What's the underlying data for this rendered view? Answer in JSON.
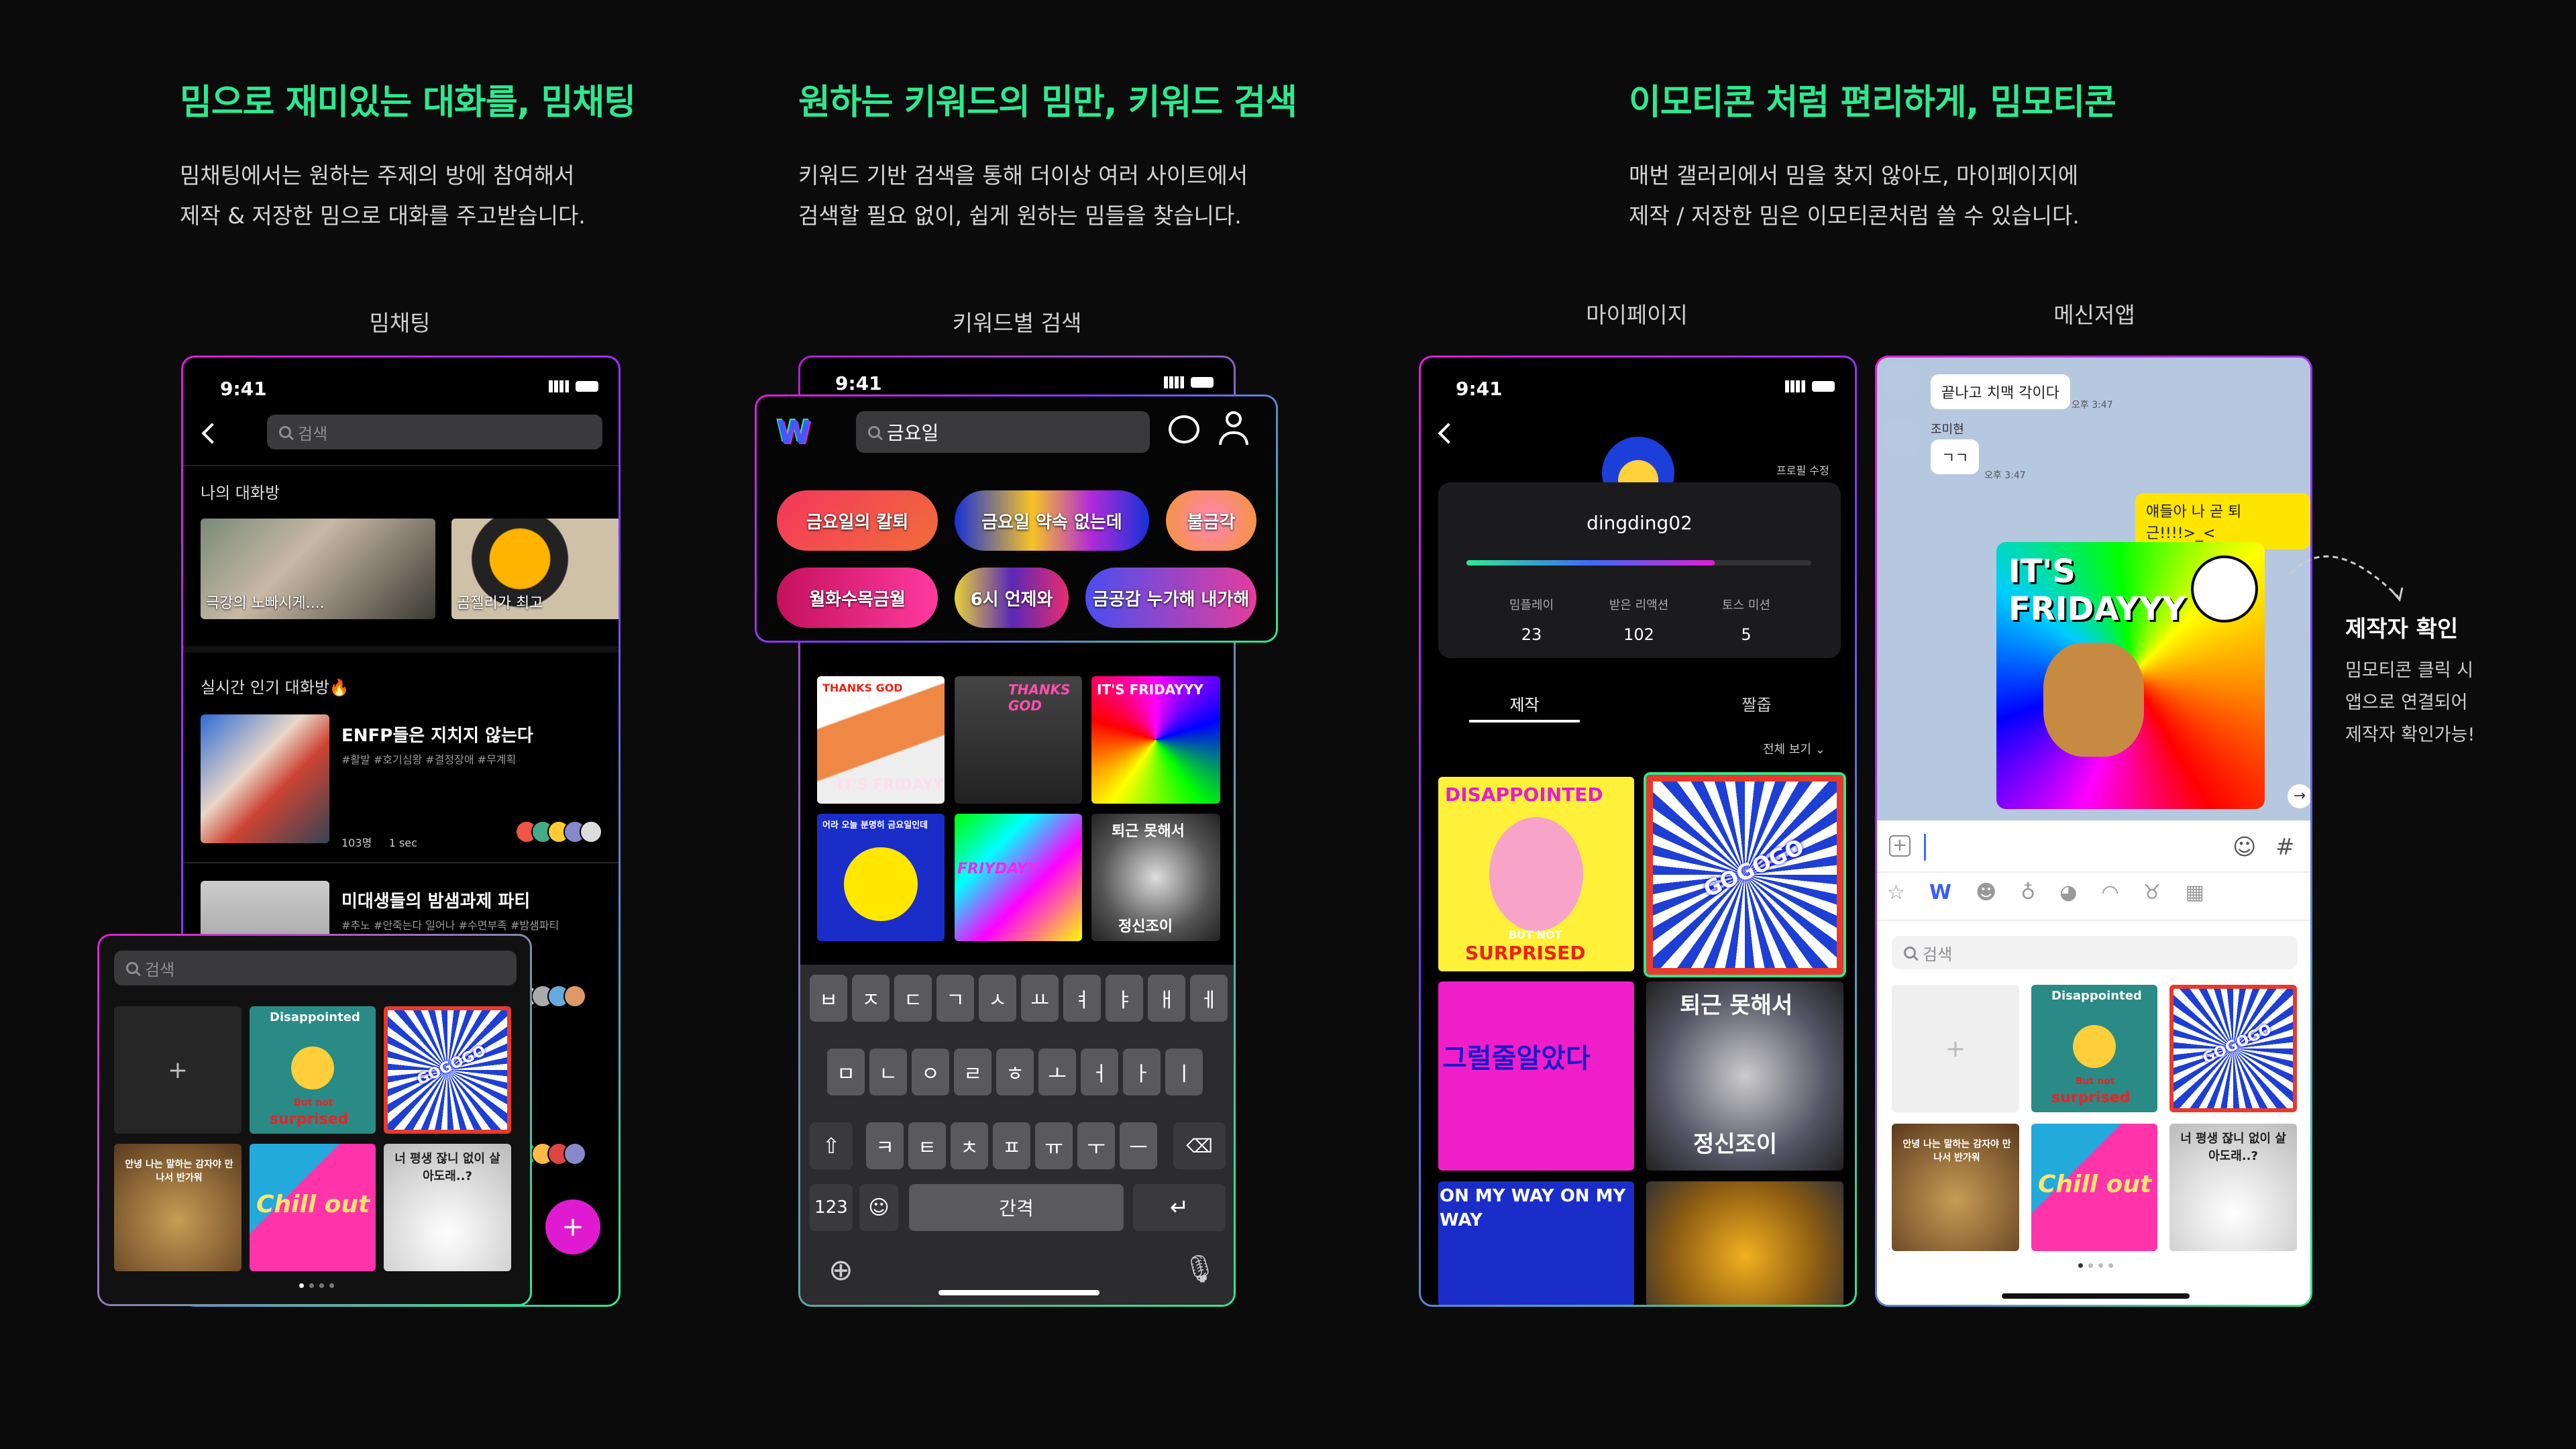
{
  "sections": [
    {
      "title": "밈으로 재미있는 대화를, 밈채팅",
      "desc1": "밈채팅에서는 원하는 주제의 방에 참여해서",
      "desc2": "제작 & 저장한 밈으로 대화를 주고받습니다."
    },
    {
      "title": "원하는 키워드의 밈만, 키워드 검색",
      "desc1": "키워드 기반 검색을 통해 더이상 여러 사이트에서",
      "desc2": "검색할 필요 없이, 쉽게 원하는 밈들을 찾습니다."
    },
    {
      "title": "이모티콘 처럼 편리하게, 밈모티콘",
      "desc1": "매번 갤러리에서 밈을 찾지 않아도, 마이페이지에",
      "desc2": "제작 / 저장한 밈은 이모티콘처럼 쓸 수 있습니다."
    }
  ],
  "labels": {
    "chat": "밈채팅",
    "keyword": "키워드별 검색",
    "mypage": "마이페이지",
    "messenger": "메신저앱"
  },
  "status_time": "9:41",
  "chat": {
    "search_placeholder": "검색",
    "my_rooms": "나의 대화방",
    "rooms": [
      "극강의 노빠시게....",
      "곰젤리가 최고"
    ],
    "popular": "실시간 인기 대화방🔥",
    "hot": [
      {
        "title": "ENFP들은 지치지 않는다",
        "tags": "#활발 #호기심왕 #결정장애 #무계획",
        "count": "103명",
        "time": "1 sec"
      },
      {
        "title": "미대생들의 밤샘과제 파티",
        "tags": "#추노 #안죽는다 일어나 #수면부족 #밤샘파티"
      }
    ],
    "fab": "+",
    "picker_search": "검색",
    "picker_add": "+",
    "memes": [
      "Disappointed",
      "But not",
      "surprised",
      "GOGOGO",
      "안녕 나는 말하는 감자야 만나서 반가워",
      "Chill out",
      "너 평생 잖니 없이 살아도래..?"
    ]
  },
  "keyword": {
    "query": "금요일",
    "chips": [
      "금요일의 칼퇴",
      "금요일 약속 없는데",
      "불금각",
      "월화수목금월",
      "6시 언제와",
      "금공감 누가해 내가해"
    ],
    "tiles": [
      "THANKS GOD",
      "IT'S FRIDAYY",
      "THANKS GOD",
      "IT'S FRIDAYYY",
      "어라 오늘 분명히 금요일인데",
      "FRIYDAYY",
      "퇴근 못해서",
      "정신조이"
    ],
    "rows": [
      [
        "ㅂ",
        "ㅈ",
        "ㄷ",
        "ㄱ",
        "ㅅ",
        "ㅛ",
        "ㅕ",
        "ㅑ",
        "ㅐ",
        "ㅔ"
      ],
      [
        "ㅁ",
        "ㄴ",
        "ㅇ",
        "ㄹ",
        "ㅎ",
        "ㅗ",
        "ㅓ",
        "ㅏ",
        "ㅣ"
      ],
      [
        "ㅋ",
        "ㅌ",
        "ㅊ",
        "ㅍ",
        "ㅠ",
        "ㅜ",
        "ㅡ"
      ]
    ],
    "num_key": "123",
    "space": "간격"
  },
  "mypage": {
    "edit": "프로필 수정",
    "username": "dingding02",
    "progress": 0.72,
    "stats": [
      {
        "t": "밈플레이",
        "v": "23"
      },
      {
        "t": "받은 리액션",
        "v": "102"
      },
      {
        "t": "토스 미션",
        "v": "5"
      }
    ],
    "tabs": [
      "제작",
      "짤줍"
    ],
    "view_all": "전체 보기",
    "memes": [
      "DISAPPOINTED",
      "BUT NOT",
      "SURPRISED",
      "GOGOGO",
      "그럴줄알았다",
      "퇴근 못해서",
      "정신조이",
      "ON MY WAY ON MY WAY"
    ]
  },
  "messenger": {
    "msg1": "끝나고 치맥 각이다",
    "time1": "오후 3:47",
    "name2": "조미현",
    "msg2": "ㄱㄱ",
    "time2": "오후 3:47",
    "mine": "얘들아 나 곧 퇴근!!!!>_<",
    "sticker": "IT'S FRIDAYYY",
    "search_placeholder": "검색",
    "add": "+",
    "memes": [
      "Disappointed",
      "But not",
      "surprised",
      "GOGOGO",
      "안녕 나는 말하는 감자야 만나서 반가워",
      "Chill out",
      "너 평생 잖니 없이 살아도래..?"
    ]
  },
  "callout": {
    "title": "제작자 확인",
    "line1": "밈모티콘 클릭 시",
    "line2": "앱으로 연결되어",
    "line3": "제작자 확인가능!"
  }
}
